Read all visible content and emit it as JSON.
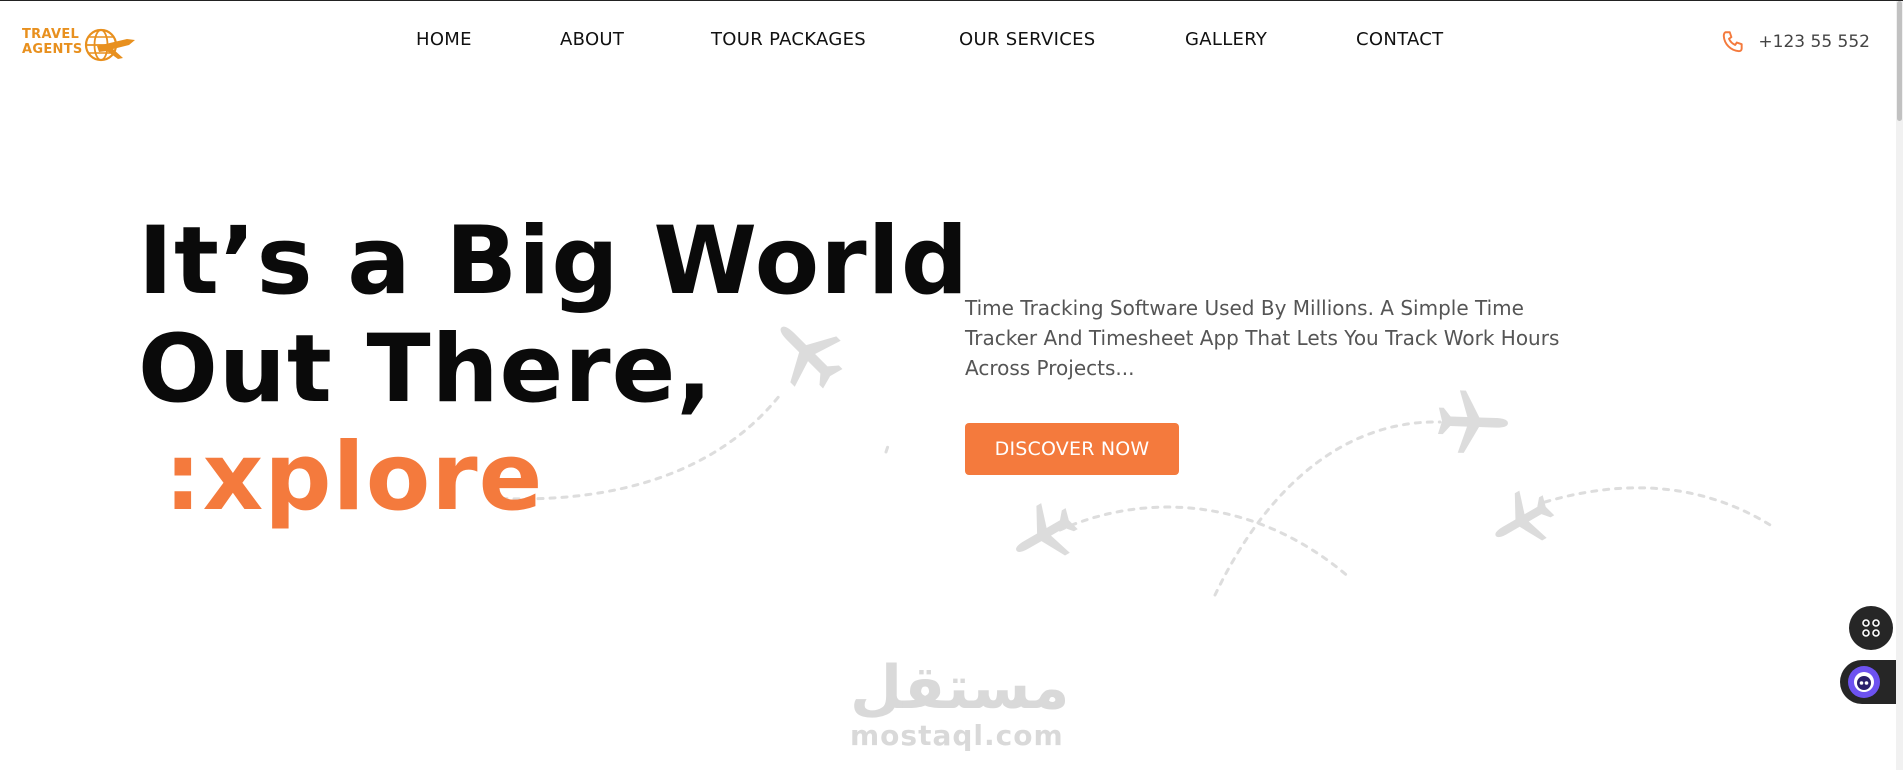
{
  "header": {
    "logo": {
      "line1": "TRAVEL",
      "line2": "AGENTS"
    },
    "nav": [
      {
        "label": "HOME"
      },
      {
        "label": "ABOUT"
      },
      {
        "label": "TOUR PACKAGES"
      },
      {
        "label": "OUR SERVICES"
      },
      {
        "label": "GALLERY"
      },
      {
        "label": "CONTACT"
      }
    ],
    "phone": {
      "icon": "phone-icon",
      "number": "+123 55 552"
    }
  },
  "hero": {
    "title_line1": "It’s a Big World",
    "title_line2": "Out There,",
    "title_accent": ":xplore",
    "description": "Time Tracking Software Used By Millions. A Simple Time Tracker And Timesheet App That Lets You Track Work Hours Across Projects...",
    "cta_label": "DISCOVER NOW"
  },
  "watermark": {
    "arabic": "مستقل",
    "latin": "mostaql.com"
  },
  "colors": {
    "accent": "#f47a3d",
    "logo": "#e8901e",
    "text": "#0a0a0a",
    "muted": "#555555",
    "decor": "#dddddd",
    "widget": "#262626"
  },
  "widgets": {
    "grid_icon": "command-icon",
    "chat_icon": "chat-bot-icon"
  }
}
